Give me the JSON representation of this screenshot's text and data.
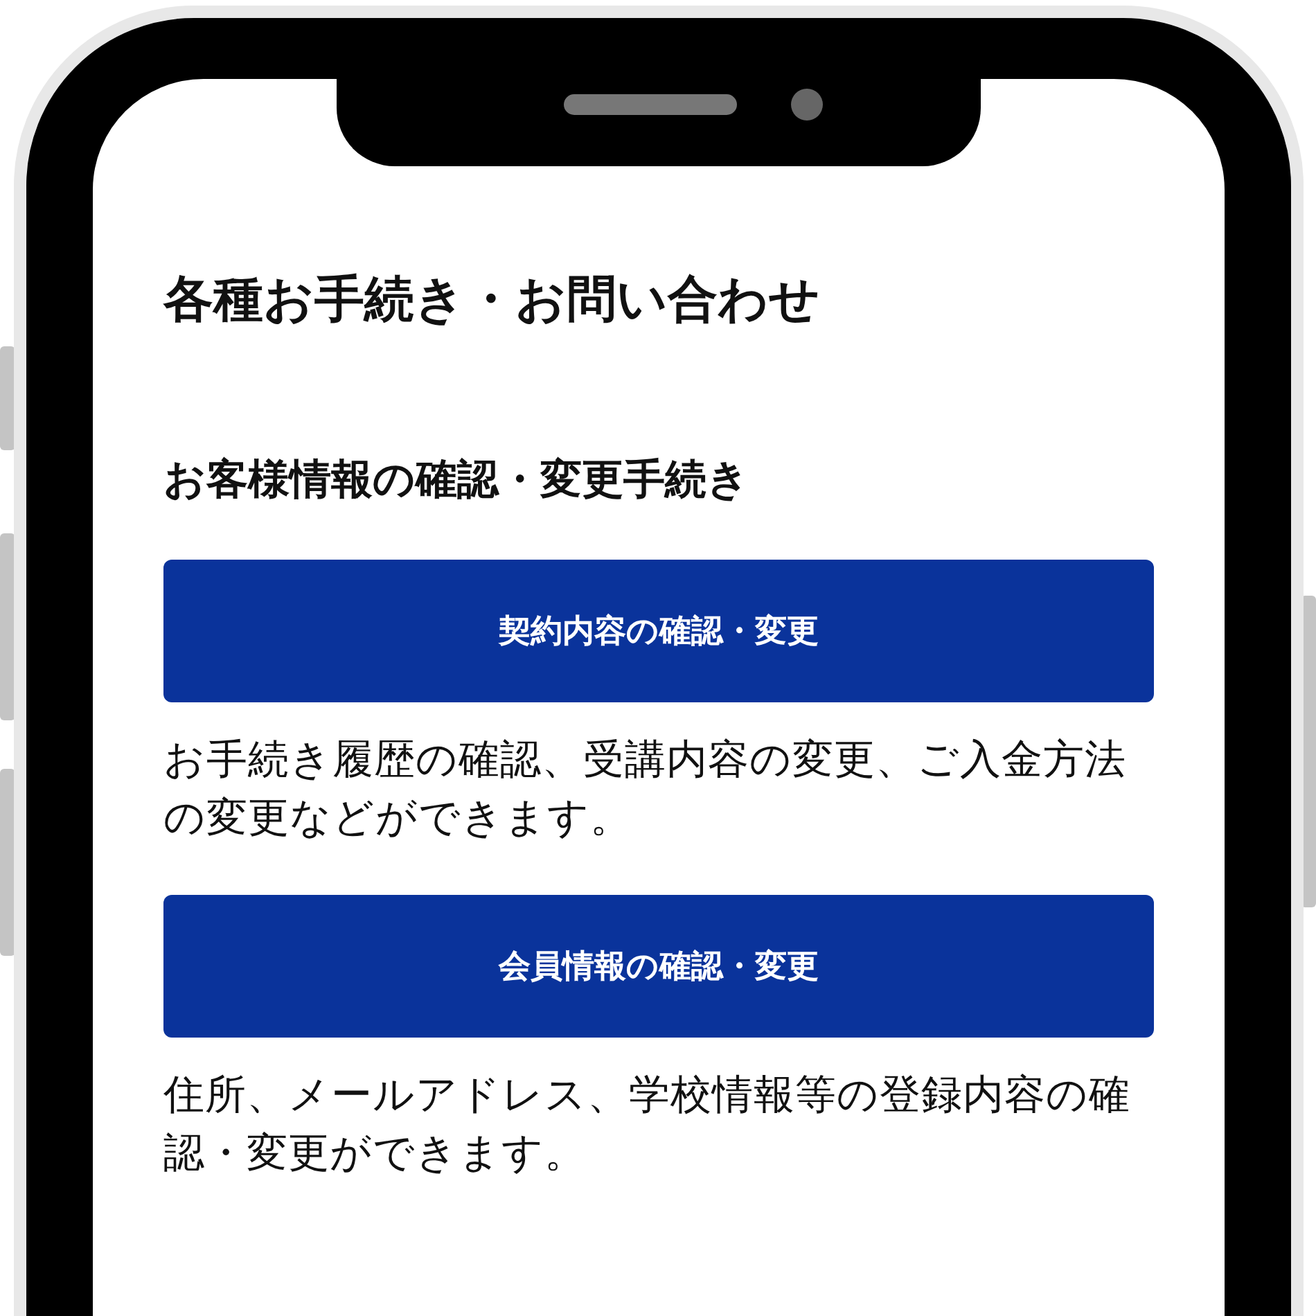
{
  "title": "各種お手続き・お問い合わせ",
  "section_title": "お客様情報の確認・変更手続き",
  "actions": [
    {
      "button": "契約内容の確認・変更",
      "description": "お手続き履歴の確認、受講内容の変更、ご入金方法の変更などができます。"
    },
    {
      "button": "会員情報の確認・変更",
      "description": "住所、メールアドレス、学校情報等の登録内容の確認・変更ができます。"
    }
  ]
}
